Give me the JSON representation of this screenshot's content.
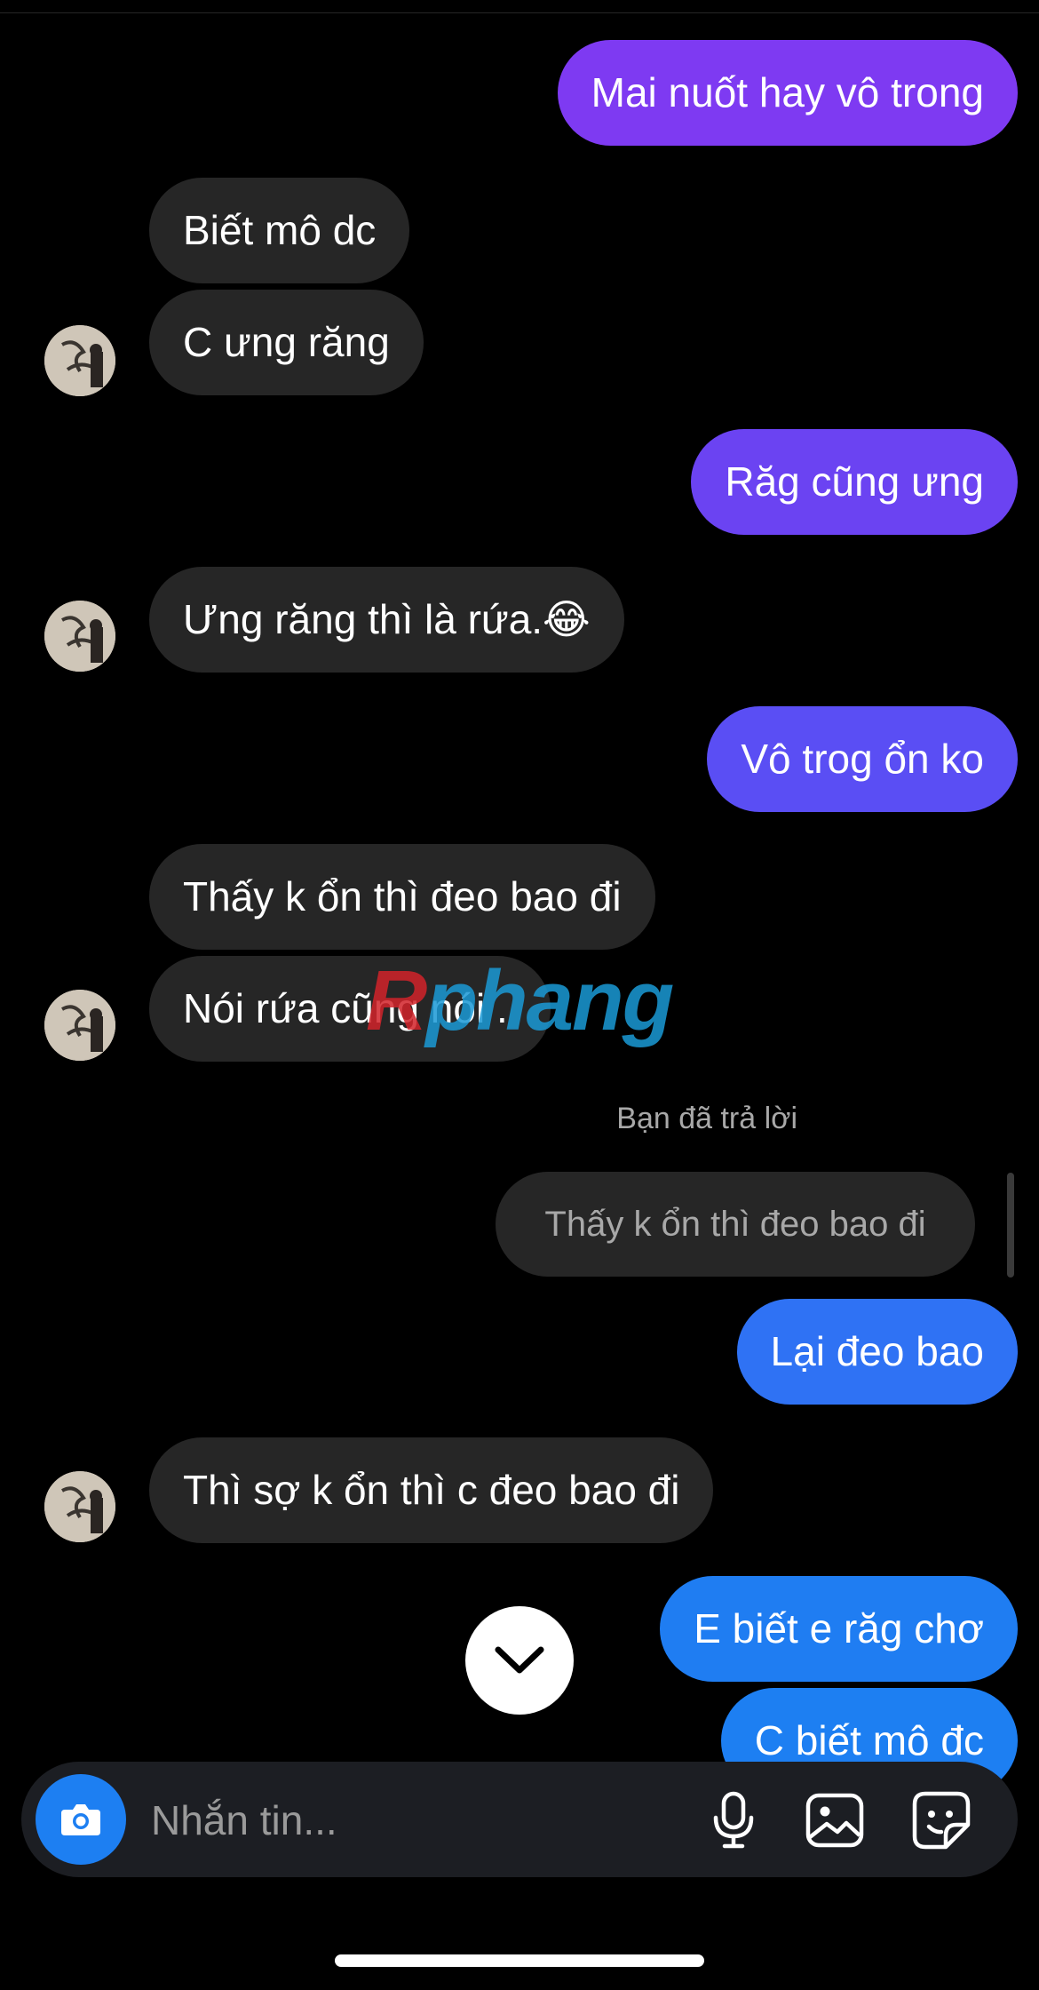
{
  "conversation": {
    "messages": [
      {
        "text": "Mai nuốt hay vô trong"
      },
      {
        "text": "Biết mô dc"
      },
      {
        "text": "C ưng răng"
      },
      {
        "text": "Răg cũng ưng"
      },
      {
        "text": "Ưng răng thì là rứa.😂"
      },
      {
        "text": "Vô trog ổn ko"
      },
      {
        "text": "Thấy k ổn thì đeo bao đi"
      },
      {
        "text": "Nói rứa cũng nói ."
      },
      {
        "text": "Lại đeo bao"
      },
      {
        "text": "Thì sợ k ổn thì c đeo bao đi"
      },
      {
        "text": "E biết e răg chơ"
      },
      {
        "text": "C biết mô đc"
      }
    ],
    "reply": {
      "label": "Bạn đã trả lời",
      "quoted_text": "Thấy k ổn thì đeo bao đi"
    }
  },
  "watermark": {
    "text": "Rphang"
  },
  "composer": {
    "placeholder": "Nhắn tin...",
    "icons": [
      "camera-icon",
      "microphone-icon",
      "image-icon",
      "sticker-icon"
    ]
  },
  "colors": {
    "background": "#000000",
    "incoming": "#262626",
    "outgoing_purple": "#7b3cf0",
    "outgoing_blue": "#1d7ff2",
    "camera_button": "#1d7ff2"
  }
}
